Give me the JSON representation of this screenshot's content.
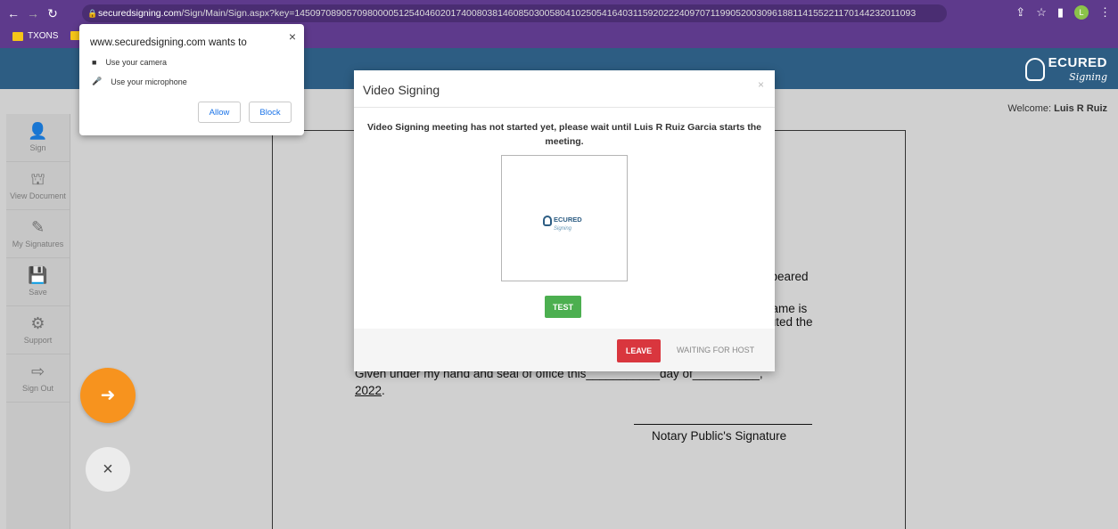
{
  "browser": {
    "url_host": "securedsigning.com",
    "url_path": "/Sign/Main/Sign.aspx?key=145097089057098000051254046020174008038146085030058041025054164031159202224097071199052003096188114155221170144232011093",
    "profile_initial": "L",
    "bookmarks": [
      {
        "label": "TXONS"
      },
      {
        "label": ""
      }
    ]
  },
  "permission_popup": {
    "title": "www.securedsigning.com wants to",
    "camera_label": "Use your camera",
    "mic_label": "Use your microphone",
    "allow_label": "Allow",
    "block_label": "Block",
    "close_symbol": "×"
  },
  "header": {
    "logo_text": "ECURED",
    "logo_sub": "Signing",
    "welcome_prefix": "Welcome: ",
    "welcome_user": "Luis R Ruiz"
  },
  "sidebar": {
    "items": [
      {
        "label": "Sign",
        "icon": "user-icon"
      },
      {
        "label": "View Document",
        "icon": "binoculars-icon"
      },
      {
        "label": "My Signatures",
        "icon": "pencil-icon"
      },
      {
        "label": "Save",
        "icon": "floppy-icon"
      },
      {
        "label": "Support",
        "icon": "gear-icon"
      },
      {
        "label": "Sign Out",
        "icon": "sign-out-icon"
      }
    ]
  },
  "document": {
    "line_appeared": "ppeared",
    "line_name_is": "name is",
    "line_executed": "cuted the",
    "line_given": "Given under my hand and seal of office this___________day of__________,",
    "line_year": "2022",
    "line_year_suffix": ".",
    "signature_caption": "Notary Public's Signature"
  },
  "modal": {
    "title": "Video Signing",
    "close_symbol": "×",
    "message": "Video Signing meeting has not started yet, please wait until Luis R Ruiz Garcia starts the meeting.",
    "video_logo_text": "ECURED",
    "video_logo_sub": "Signing",
    "test_label": "TEST",
    "leave_label": "LEAVE",
    "status_label": "WAITING FOR HOST"
  },
  "floating": {
    "close_symbol": "×"
  },
  "colors": {
    "browser_chrome": "#5e3a8c",
    "app_header": "#2d5d83",
    "test_button": "#4caf50",
    "leave_button": "#d9363e",
    "fab_orange": "#f7931e"
  }
}
